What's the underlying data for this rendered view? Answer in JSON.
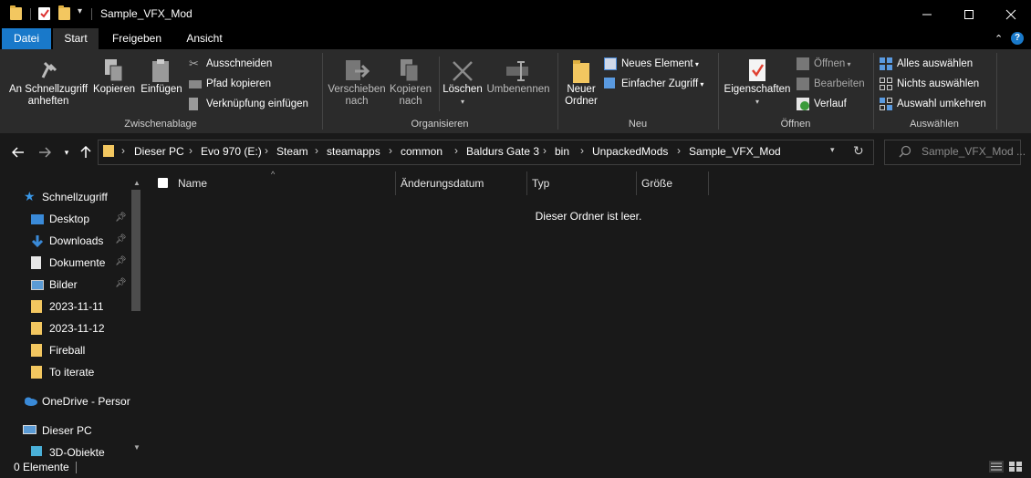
{
  "window": {
    "title": "Sample_VFX_Mod",
    "controls": [
      "minimize-icon",
      "maximize-icon",
      "close-icon"
    ]
  },
  "tabs": [
    {
      "label": "Datei"
    },
    {
      "label": "Start"
    },
    {
      "label": "Freigeben"
    },
    {
      "label": "Ansicht"
    }
  ],
  "ribbon": {
    "clipboard": {
      "group_label": "Zwischenablage",
      "pin_quick": "An Schnellzugriff\nanheften",
      "copy": "Kopieren",
      "paste": "Einfügen",
      "cut": "Ausschneiden",
      "copy_path": "Pfad kopieren",
      "paste_shortcut": "Verknüpfung einfügen"
    },
    "organize": {
      "group_label": "Organisieren",
      "move_to": "Verschieben\nnach",
      "copy_to": "Kopieren\nnach",
      "delete": "Löschen",
      "rename": "Umbenennen"
    },
    "new": {
      "group_label": "Neu",
      "new_folder": "Neuer\nOrdner",
      "new_item": "Neues Element",
      "easy_access": "Einfacher Zugriff"
    },
    "open": {
      "group_label": "Öffnen",
      "properties": "Eigenschaften",
      "open": "Öffnen",
      "edit": "Bearbeiten",
      "history": "Verlauf"
    },
    "select": {
      "group_label": "Auswählen",
      "select_all": "Alles auswählen",
      "select_none": "Nichts auswählen",
      "invert": "Auswahl umkehren"
    }
  },
  "address": {
    "crumbs": [
      "Dieser PC",
      "Evo 970 (E:)",
      "Steam",
      "steamapps",
      "common",
      "Baldurs Gate 3",
      "bin",
      "UnpackedMods",
      "Sample_VFX_Mod"
    ],
    "search_placeholder": "Sample_VFX_Mod ..."
  },
  "navpane": {
    "quick_access": "Schnellzugriff",
    "items": [
      {
        "label": "Desktop",
        "pinned": true
      },
      {
        "label": "Downloads",
        "pinned": true
      },
      {
        "label": "Dokumente",
        "pinned": true
      },
      {
        "label": "Bilder",
        "pinned": true
      },
      {
        "label": "2023-11-11",
        "pinned": false
      },
      {
        "label": "2023-11-12",
        "pinned": false
      },
      {
        "label": "Fireball",
        "pinned": false
      },
      {
        "label": "To iterate",
        "pinned": false
      }
    ],
    "onedrive": "OneDrive - Persor",
    "this_pc": "Dieser PC",
    "objects3d": "3D-Objekte"
  },
  "columns": [
    "Name",
    "Änderungsdatum",
    "Typ",
    "Größe"
  ],
  "content": {
    "empty_message": "Dieser Ordner ist leer."
  },
  "status": {
    "count": "0 Elemente"
  },
  "colors": {
    "accent_blue": "#1979ca",
    "folder_yellow": "#f3c760",
    "background": "#191919",
    "ribbon": "#2b2b2b"
  }
}
